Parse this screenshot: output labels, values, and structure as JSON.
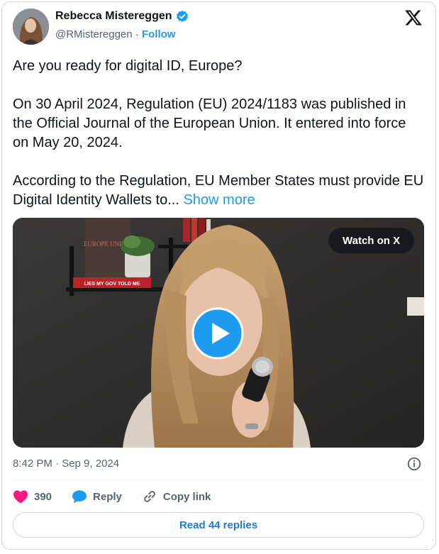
{
  "author": {
    "name": "Rebecca Mistereggen",
    "handle": "@RMistereggen",
    "separator": " · ",
    "follow_label": "Follow",
    "verified_icon": "verified-badge-icon"
  },
  "tweet": {
    "paragraphs": [
      "Are you ready for digital ID, Europe?",
      "On 30 April 2024, Regulation (EU) 2024/1183 was published in the Official Journal of the European Union. It entered into force on May 20, 2024.",
      "According to the Regulation, EU Member States must provide EU Digital Identity Wallets to... "
    ],
    "show_more_label": "Show more"
  },
  "media": {
    "watch_label": "Watch on X",
    "play_icon": "play-icon",
    "book_spine_text": "LIES MY GOV TOLD ME",
    "book_cover_text": "EUROPE UNDER"
  },
  "meta": {
    "timestamp": "8:42 PM · Sep 9, 2024",
    "info_icon": "info-icon"
  },
  "actions": {
    "like_count": "390",
    "reply_label": "Reply",
    "copy_link_label": "Copy link"
  },
  "read_replies_label": "Read 44 replies",
  "colors": {
    "accent": "#1d9bf0",
    "like": "#f91880",
    "text_secondary": "#536471",
    "border": "#cfd9de"
  }
}
